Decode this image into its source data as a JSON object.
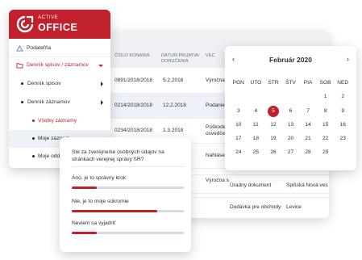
{
  "brand": {
    "top": "ACTIVE",
    "main": "OFFICE"
  },
  "sidebar": {
    "items": [
      {
        "label": "Podateľňa"
      },
      {
        "label": "Denník spisov / záznamov"
      },
      {
        "label": "Denník spisov"
      },
      {
        "label": "Denník záznamov"
      },
      {
        "label": "Všetky záznamy"
      },
      {
        "label": "Moje záznam"
      },
      {
        "label": "Moje odde"
      }
    ]
  },
  "table": {
    "headers": [
      "ČÍSLO KONANIA",
      "DÁTUM PRIJATIA/ DORUČENIA",
      "VEC"
    ],
    "rows": [
      {
        "number": "0891/2018/2018",
        "date": "5.2.2018",
        "subject": "Výročna s"
      },
      {
        "number": "0214/2018/2018",
        "date": "12.2.2018",
        "subject": "Podanie S"
      },
      {
        "number": "0234/2018/2018",
        "date": "1.3.2018",
        "subject": "Poškoden osvedčeni"
      },
      {
        "number": "",
        "date": "",
        "subject": "Nahlásen"
      },
      {
        "number": "",
        "date": "",
        "subject": "Výročna s"
      },
      {
        "number": "",
        "date": "",
        "subject": "Úradny dokument",
        "place": "Spišská Nová ves"
      },
      {
        "number": "",
        "date": "",
        "subject": "Dodávka pre obchody",
        "place": "Levice"
      }
    ]
  },
  "calendar": {
    "month": "Február 2020",
    "prev_icon": "chevron-left-icon",
    "next_icon": "chevron-right-icon",
    "weekdays": [
      "PON",
      "UTO",
      "STR",
      "ŠTV",
      "PIA",
      "SOB",
      "NED"
    ],
    "days": [
      "",
      "",
      "",
      "",
      "",
      "1",
      "2",
      "3",
      "4",
      "5",
      "6",
      "7",
      "8",
      "9",
      "10",
      "11",
      "12",
      "13",
      "14",
      "15",
      "16",
      "17",
      "18",
      "19",
      "20",
      "21",
      "22",
      "23",
      "24",
      "25",
      "26",
      "27",
      "28",
      "29",
      ""
    ],
    "today": "5",
    "accent": "#c0212d"
  },
  "poll": {
    "question": "Ste za zverejnenie osobných údajov na stránkach verejnej správy SR?",
    "options": [
      {
        "label": "Áno, je to správny krok",
        "fraction": 0.22
      },
      {
        "label": "Nie, je to moje súkromie",
        "fraction": 0.76
      },
      {
        "label": "Neviem sa vyjadriť",
        "fraction": 0.22
      }
    ]
  }
}
